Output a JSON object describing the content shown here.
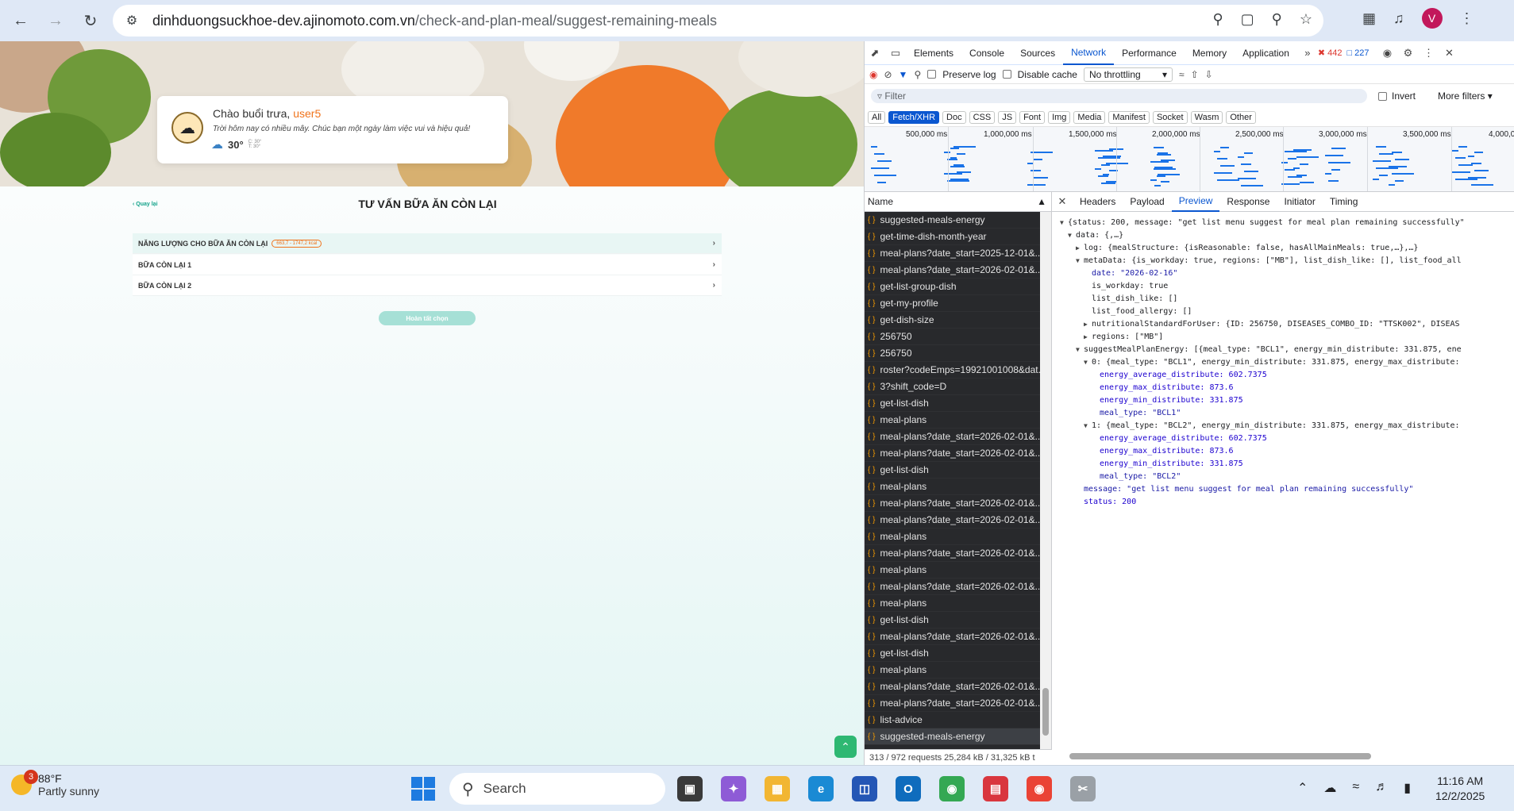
{
  "browser": {
    "url_domain": "dinhduongsuckhoe-dev.ajinomoto.com.vn",
    "url_path": "/check-and-plan-meal/suggest-remaining-meals",
    "profile_initial": "V"
  },
  "page": {
    "greeting": "Chào buổi trưa,",
    "user": "user5",
    "greeting_sub": "Trời hôm nay có nhiều mây. Chúc bạn một ngày làm việc vui và hiệu quả!",
    "temperature": "30°",
    "temp_max": "C: 30°",
    "temp_min": "T: 30°",
    "back_label": "Quay lại",
    "title": "TƯ VẤN BỮA ĂN CÒN LẠI",
    "sections": [
      {
        "label": "NĂNG LƯỢNG CHO BỮA ĂN CÒN LẠI",
        "badge": "663,7 - 1747,2 kcal"
      },
      {
        "label": "BỮA CÒN LẠI 1",
        "badge": ""
      },
      {
        "label": "BỮA CÒN LẠI 2",
        "badge": ""
      }
    ],
    "finish_button": "Hoàn tất chọn"
  },
  "devtools": {
    "tabs": [
      "Elements",
      "Console",
      "Sources",
      "Network",
      "Performance",
      "Memory",
      "Application"
    ],
    "active_tab": "Network",
    "error_count": "442",
    "warning_count": "227",
    "preserve_log": "Preserve log",
    "disable_cache": "Disable cache",
    "throttling": "No throttling",
    "filter_placeholder": "Filter",
    "invert": "Invert",
    "more_filters": "More filters",
    "type_filters": [
      "All",
      "Fetch/XHR",
      "Doc",
      "CSS",
      "JS",
      "Font",
      "Img",
      "Media",
      "Manifest",
      "Socket",
      "Wasm",
      "Other"
    ],
    "active_type": "Fetch/XHR",
    "timeline_ticks": [
      "500,000 ms",
      "1,000,000 ms",
      "1,500,000 ms",
      "2,000,000 ms",
      "2,500,000 ms",
      "3,000,000 ms",
      "3,500,000 ms",
      "4,000,0"
    ],
    "name_header": "Name",
    "requests": [
      "suggested-meals-energy",
      "get-time-dish-month-year",
      "meal-plans?date_start=2025-12-01&...",
      "meal-plans?date_start=2026-02-01&...",
      "get-list-group-dish",
      "get-my-profile",
      "get-dish-size",
      "256750",
      "256750",
      "roster?codeEmps=19921001008&dat...",
      "3?shift_code=D",
      "get-list-dish",
      "meal-plans",
      "meal-plans?date_start=2026-02-01&...",
      "meal-plans?date_start=2026-02-01&...",
      "get-list-dish",
      "meal-plans",
      "meal-plans?date_start=2026-02-01&...",
      "meal-plans?date_start=2026-02-01&...",
      "meal-plans",
      "meal-plans?date_start=2026-02-01&...",
      "meal-plans",
      "meal-plans?date_start=2026-02-01&...",
      "meal-plans",
      "get-list-dish",
      "meal-plans?date_start=2026-02-01&...",
      "get-list-dish",
      "meal-plans",
      "meal-plans?date_start=2026-02-01&...",
      "meal-plans?date_start=2026-02-01&...",
      "list-advice",
      "suggested-meals-energy"
    ],
    "status_bar": "313 / 972 requests  25,284 kB / 31,325 kB t",
    "detail_tabs": [
      "Headers",
      "Payload",
      "Preview",
      "Response",
      "Initiator",
      "Timing"
    ],
    "active_detail_tab": "Preview",
    "preview_lines": [
      "{status: 200, message: \"get list menu suggest for meal plan remaining successfully\"",
      "data: {,…}",
      "log: {mealStructure: {isReasonable: false, hasAllMainMeals: true,…},…}",
      "metaData: {is_workday: true, regions: [\"MB\"], list_dish_like: [], list_food_all",
      "date: \"2026-02-16\"",
      "is_workday: true",
      "list_dish_like: []",
      "list_food_allergy: []",
      "nutritionalStandardForUser: {ID: 256750, DISEASES_COMBO_ID: \"TTSK002\", DISEAS",
      "regions: [\"MB\"]",
      "suggestMealPlanEnergy: [{meal_type: \"BCL1\", energy_min_distribute: 331.875, ene",
      "0: {meal_type: \"BCL1\", energy_min_distribute: 331.875, energy_max_distribute:",
      "energy_average_distribute: 602.7375",
      "energy_max_distribute: 873.6",
      "energy_min_distribute: 331.875",
      "meal_type: \"BCL1\"",
      "1: {meal_type: \"BCL2\", energy_min_distribute: 331.875, energy_max_distribute:",
      "energy_average_distribute: 602.7375",
      "energy_max_distribute: 873.6",
      "energy_min_distribute: 331.875",
      "meal_type: \"BCL2\"",
      "message: \"get list menu suggest for meal plan remaining successfully\"",
      "status: 200"
    ]
  },
  "taskbar": {
    "weather_temp": "88°F",
    "weather_desc": "Partly sunny",
    "weather_badge": "3",
    "search": "Search",
    "time": "11:16 AM",
    "date": "12/2/2025"
  }
}
